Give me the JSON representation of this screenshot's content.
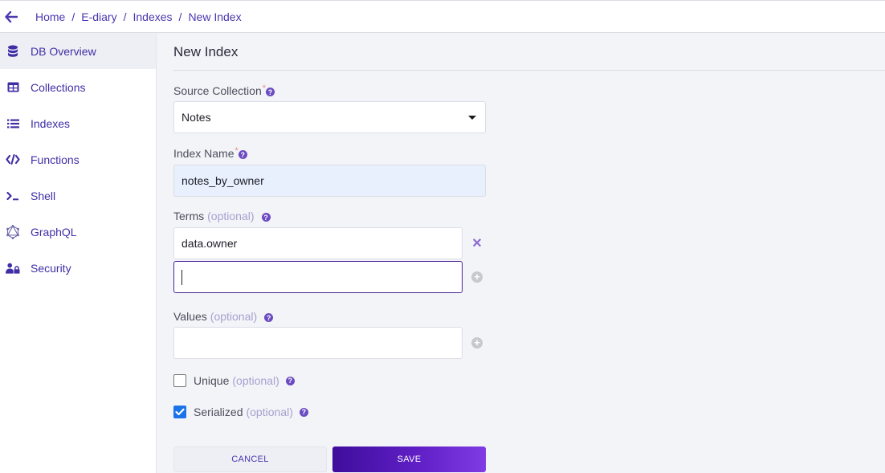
{
  "header": {
    "back_icon": "arrow-left-icon",
    "breadcrumb": [
      "Home",
      "E-diary",
      "Indexes",
      "New Index"
    ],
    "separator": "/"
  },
  "sidebar": {
    "items": [
      {
        "label": "DB Overview",
        "icon": "database-icon",
        "active": true
      },
      {
        "label": "Collections",
        "icon": "table-icon",
        "active": false
      },
      {
        "label": "Indexes",
        "icon": "list-icon",
        "active": false
      },
      {
        "label": "Functions",
        "icon": "code-icon",
        "active": false
      },
      {
        "label": "Shell",
        "icon": "terminal-icon",
        "active": false
      },
      {
        "label": "GraphQL",
        "icon": "graphql-icon",
        "active": false
      },
      {
        "label": "Security",
        "icon": "user-lock-icon",
        "active": false
      }
    ]
  },
  "form": {
    "title": "New Index",
    "required_mark": "*",
    "help_glyph": "?",
    "optional_label": "(optional)",
    "source_collection": {
      "label": "Source Collection",
      "value": "Notes"
    },
    "index_name": {
      "label": "Index Name",
      "value": "notes_by_owner"
    },
    "terms": {
      "label": "Terms",
      "values": [
        "data.owner",
        ""
      ],
      "remove_glyph": "✕",
      "add_glyph": "+"
    },
    "values": {
      "label": "Values",
      "value": "",
      "add_glyph": "+"
    },
    "unique": {
      "label": "Unique",
      "checked": false
    },
    "serialized": {
      "label": "Serialized",
      "checked": true
    },
    "cancel_label": "CANCEL",
    "save_label": "SAVE"
  },
  "colors": {
    "accent": "#4b37b0",
    "save_gradient_start": "#3e0d9c",
    "save_gradient_end": "#7f3be4",
    "checkbox_checked": "#1a73e8",
    "autofill_bg": "#e8f0fd"
  }
}
